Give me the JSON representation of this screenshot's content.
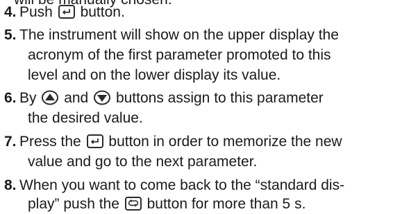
{
  "top_fragment": "will be manually chosen.",
  "steps": [
    {
      "number": "4.",
      "lines": [
        "Push",
        "button."
      ]
    },
    {
      "number": "5.",
      "lines": [
        "The instrument will show on the upper display the",
        "acronym of the first parameter promoted to this",
        "level and on the lower display its value."
      ]
    },
    {
      "number": "6.",
      "line1_parts": [
        "By",
        "and",
        "buttons assign to this parameter"
      ],
      "line2": "the desired value."
    },
    {
      "number": "7.",
      "line1_parts": [
        "Press the",
        "button in order to memorize the new"
      ],
      "line2": "value and go to the next parameter."
    },
    {
      "number": "8.",
      "line1": "When you want to come back to the “standard dis-",
      "line2_parts": [
        "play” push the",
        "button for more than 5 s."
      ]
    }
  ],
  "icons": {
    "enter": "enter-key-icon",
    "up": "up-arrow-key-icon",
    "down": "down-arrow-key-icon",
    "loop": "loop-key-icon"
  }
}
